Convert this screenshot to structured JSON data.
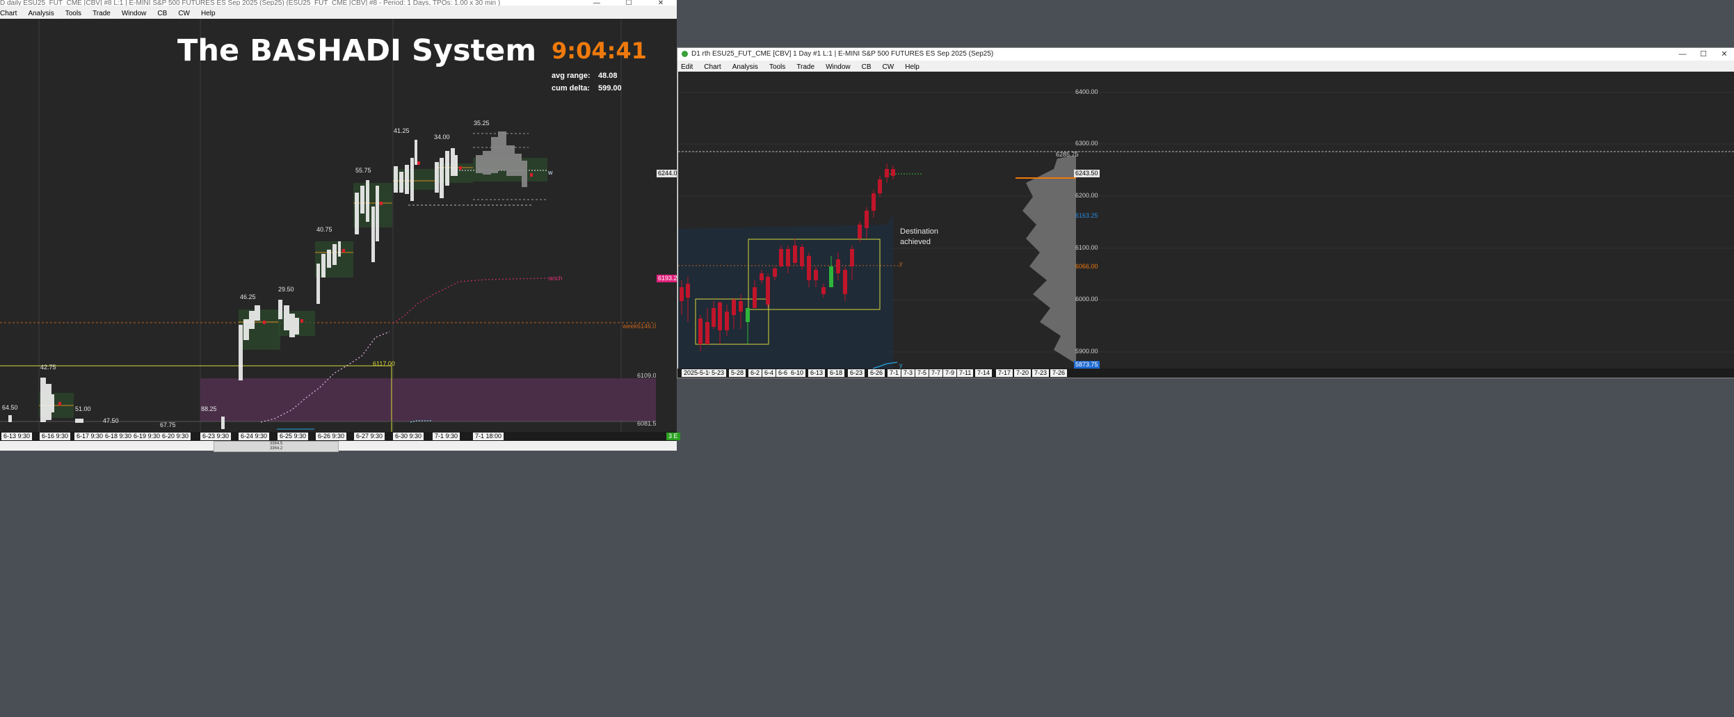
{
  "left_window": {
    "title": "D daily ESU25_FUT_CME [CBV] #8 L:1 | E-MINI S&P 500 FUTURES ES Sep 2025 (Sep25) (ESU25_FUT_CME [CBV] #8 - Period: 1 Days, TPOs: 1.00 x 30 min )",
    "menu": [
      "Chart",
      "Analysis",
      "Tools",
      "Trade",
      "Window",
      "CB",
      "CW",
      "Help"
    ],
    "controls": {
      "minimize": "—",
      "maximize": "☐",
      "close": "✕"
    },
    "heading": "The BASHADI System",
    "clock": "9:04:41",
    "avg_range_label": "avg range:",
    "avg_range_value": "48.08",
    "cum_delta_label": "cum delta:",
    "cum_delta_value": "599.00",
    "range_labels": [
      "64.50",
      "42.75",
      "51.00",
      "47.50",
      "67.75",
      "88.25",
      "46.25",
      "29.50",
      "40.75",
      "55.75",
      "41.25",
      "34.00",
      "35.25"
    ],
    "level_6117": "6117.00",
    "week_label": "week",
    "week_price": "6146.00",
    "anch_label": "anch",
    "w_label": "w",
    "right_prices": [
      "6109.00",
      "6081.50"
    ],
    "price_box_current": "6244.00",
    "price_box_anch": "6193.25",
    "x_ticks": [
      "6-13 9:30",
      "6-16 9:30",
      "6-17 9:30",
      "6-18 9:30",
      "6-19 9:30",
      "6-20 9:30",
      "6-23 9:30",
      "6-24 9:30",
      "6-25 9:30",
      "6-26 9:30",
      "6-27 9:30",
      "6-30 9:30",
      "7-1 9:30",
      "7-1 18:00"
    ],
    "corner_badge": "3 E",
    "volume_small": [
      "3364.5",
      "3364.2"
    ]
  },
  "right_window": {
    "title": "D1 rth ESU25_FUT_CME [CBV]  1 Day  #1 L:1 | E-MINI S&P 500 FUTURES ES Sep 2025 (Sep25)",
    "menu": [
      "Edit",
      "Chart",
      "Analysis",
      "Tools",
      "Trade",
      "Window",
      "CB",
      "CW",
      "Help"
    ],
    "controls": {
      "minimize": "—",
      "maximize": "☐",
      "close": "✕"
    },
    "annotation_line1": "Destination",
    "annotation_line2": "achieved",
    "y_label": "y",
    "y_label_bottom": "y",
    "axis_prices": [
      "6400.00",
      "6300.00",
      "6200.00",
      "6100.00",
      "6000.00",
      "5900.00"
    ],
    "price_hline": "6285.75",
    "price_current": "6243.50",
    "price_blue": "6163.25",
    "price_orange": "6066.00",
    "price_bottom": "5873.75",
    "x_ticks": [
      "2025-5-16",
      "5-23",
      "5-28",
      "6-2",
      "6-4",
      "6-6",
      "6-10",
      "6-13",
      "6-18",
      "6-23",
      "6-26",
      "7-1",
      "7-3",
      "7-5",
      "7-7",
      "7-9",
      "7-11",
      "7-14",
      "7-17",
      "7-20",
      "7-23",
      "7-26"
    ]
  },
  "colors": {
    "chart_bg": "#262626",
    "orange": "#f07a0c",
    "yellow": "#d9d93a",
    "magenta": "#ff2a8a",
    "candle_up": "#2fb53a",
    "candle_down": "#c0152a",
    "cyan": "#2aa6e0"
  }
}
